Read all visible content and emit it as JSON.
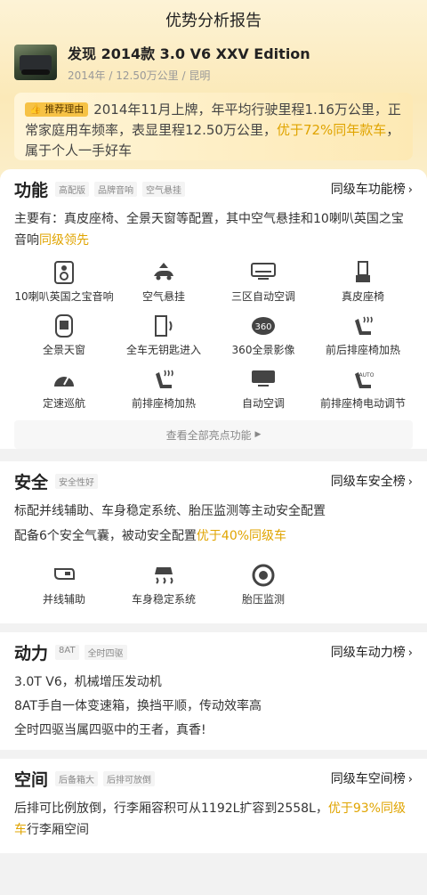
{
  "header": {
    "title": "优势分析报告"
  },
  "car": {
    "title": "发现 2014款 3.0 V6 XXV Edition",
    "year": "2014年",
    "mileage": "12.50万公里",
    "city": "昆明",
    "sep": "/"
  },
  "summary": {
    "tag": "推荐理由",
    "text1": "2014年11月上牌，年平均行驶里程1.16万公里，正常家庭用车频率，表显里程12.50万公里，",
    "highlight": "优于72%同年款车",
    "text2": "，属于个人一手好车"
  },
  "function": {
    "title": "功能",
    "chips": [
      "高配版",
      "品牌音响",
      "空气悬挂"
    ],
    "rank": "同级车功能榜",
    "desc": "主要有：真皮座椅、全景天窗等配置，其中空气悬挂和10喇叭英国之宝音响",
    "desc_hl": "同级领先",
    "more": "查看全部亮点功能",
    "items": [
      {
        "label": "10喇叭英国之宝音响",
        "icon": "speaker-icon"
      },
      {
        "label": "空气悬挂",
        "icon": "air-suspension-icon"
      },
      {
        "label": "三区自动空调",
        "icon": "ac-icon"
      },
      {
        "label": "真皮座椅",
        "icon": "seat-icon"
      },
      {
        "label": "全景天窗",
        "icon": "sunroof-icon"
      },
      {
        "label": "全车无钥匙进入",
        "icon": "keyless-icon"
      },
      {
        "label": "360全景影像",
        "icon": "camera-360-icon"
      },
      {
        "label": "前后排座椅加热",
        "icon": "seat-heat-icon"
      },
      {
        "label": "定速巡航",
        "icon": "cruise-icon"
      },
      {
        "label": "前排座椅加热",
        "icon": "seat-heat-icon"
      },
      {
        "label": "自动空调",
        "icon": "auto-ac-icon"
      },
      {
        "label": "前排座椅电动调节",
        "icon": "power-seat-icon"
      }
    ]
  },
  "safety": {
    "title": "安全",
    "chips": [
      "安全性好"
    ],
    "rank": "同级车安全榜",
    "line1": "标配并线辅助、车身稳定系统、胎压监测等主动安全配置",
    "line2": "配备6个安全气囊，被动安全配置",
    "line2_hl": "优于40%同级车",
    "items": [
      {
        "label": "并线辅助",
        "icon": "mirror-icon"
      },
      {
        "label": "车身稳定系统",
        "icon": "stability-icon"
      },
      {
        "label": "胎压监测",
        "icon": "tire-icon"
      }
    ]
  },
  "power": {
    "title": "动力",
    "chips": [
      "8AT",
      "全时四驱"
    ],
    "rank": "同级车动力榜",
    "lines": [
      "3.0T V6，机械增压发动机",
      "8AT手自一体变速箱，换挡平顺，传动效率高",
      "全时四驱当属四驱中的王者，真香!"
    ]
  },
  "space": {
    "title": "空间",
    "chips": [
      "后备箱大",
      "后排可放倒"
    ],
    "rank": "同级车空间榜",
    "text": "后排可比例放倒，行李厢容积可从1192L扩容到2558L，",
    "hl": "优于93%同级车",
    "text2": "行李厢空间"
  },
  "colors": {
    "accent": "#e0a400",
    "tag": "#f6c245"
  }
}
